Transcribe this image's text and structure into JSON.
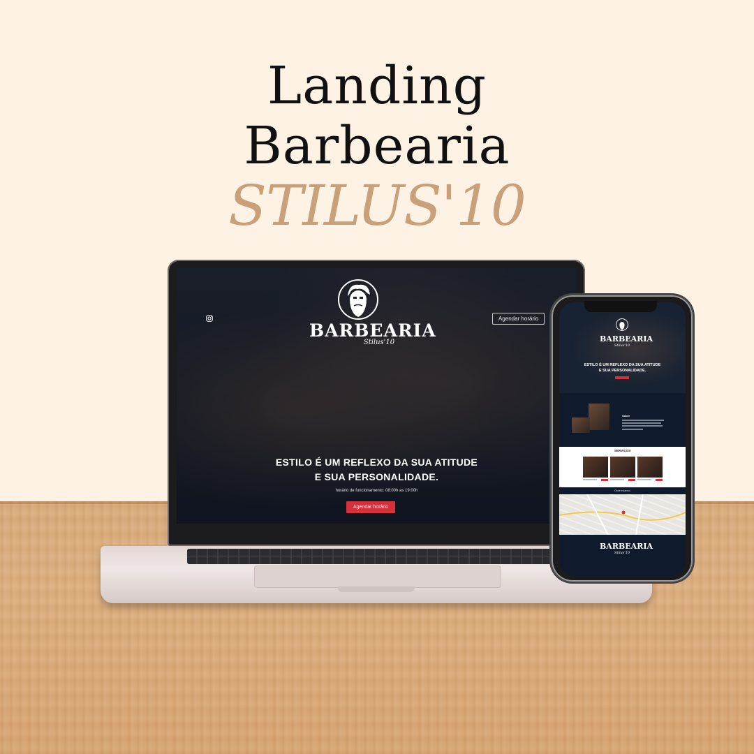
{
  "headline": {
    "line1": "Landing",
    "line2": "Barbearia",
    "line3": "STILUS'10"
  },
  "laptop_site": {
    "logo_word": "BARBEARIA",
    "logo_sub": "Stilus'10",
    "cta_top": "Agendar horário",
    "hero_line1": "ESTILO É UM REFLEXO DA SUA ATITUDE",
    "hero_line2": "E SUA PERSONALIDADE.",
    "hours": "horário de funcionamento: 08:00h as 19:00h",
    "cta_main": "Agendar horário"
  },
  "phone_site": {
    "logo_word": "BARBEARIA",
    "logo_sub": "Stilus'10",
    "hero_line1": "ESTILO É UM REFLEXO DA SUA ATITUDE",
    "hero_line2": "E SUA PERSONALIDADE.",
    "about_title": "Sobre",
    "services_title": "SERVIÇOS",
    "map_label": "Onde estamos"
  },
  "colors": {
    "background": "#fdf2e3",
    "accent_gold": "#c8a07a",
    "cta_red": "#d6303a",
    "site_navy": "#0f1b2c"
  },
  "icons": [
    "instagram-icon",
    "bearded-man-logo-icon"
  ]
}
